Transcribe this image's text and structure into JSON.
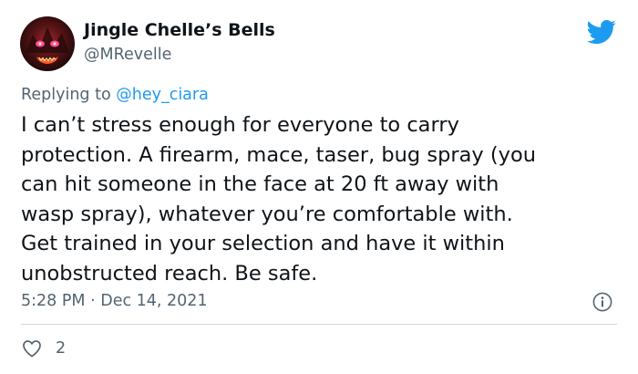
{
  "tweet": {
    "author": {
      "display_name": "Jingle Chelle’s Bells",
      "handle": "@MRevelle",
      "avatar": "avatar-image"
    },
    "reply": {
      "prefix": "Replying to ",
      "mention": "@hey_ciara"
    },
    "body_lines": [
      "I can’t stress enough for everyone to carry",
      "protection. A firearm, mace, taser, bug spray (you",
      "can hit someone in the face at 20 ft away with",
      "wasp spray), whatever you’re comfortable with.",
      "Get trained in your selection and have it within",
      "unobstructed reach. Be safe."
    ],
    "time": "5:28 PM",
    "separator": " · ",
    "date": "Dec 14, 2021",
    "likes": "2"
  },
  "icons": {
    "brand": "twitter-bird-icon",
    "info": "info-icon",
    "like": "heart-icon"
  },
  "colors": {
    "brand_blue": "#1d9bf0",
    "secondary_text": "#536471",
    "divider": "#cfd9de"
  }
}
